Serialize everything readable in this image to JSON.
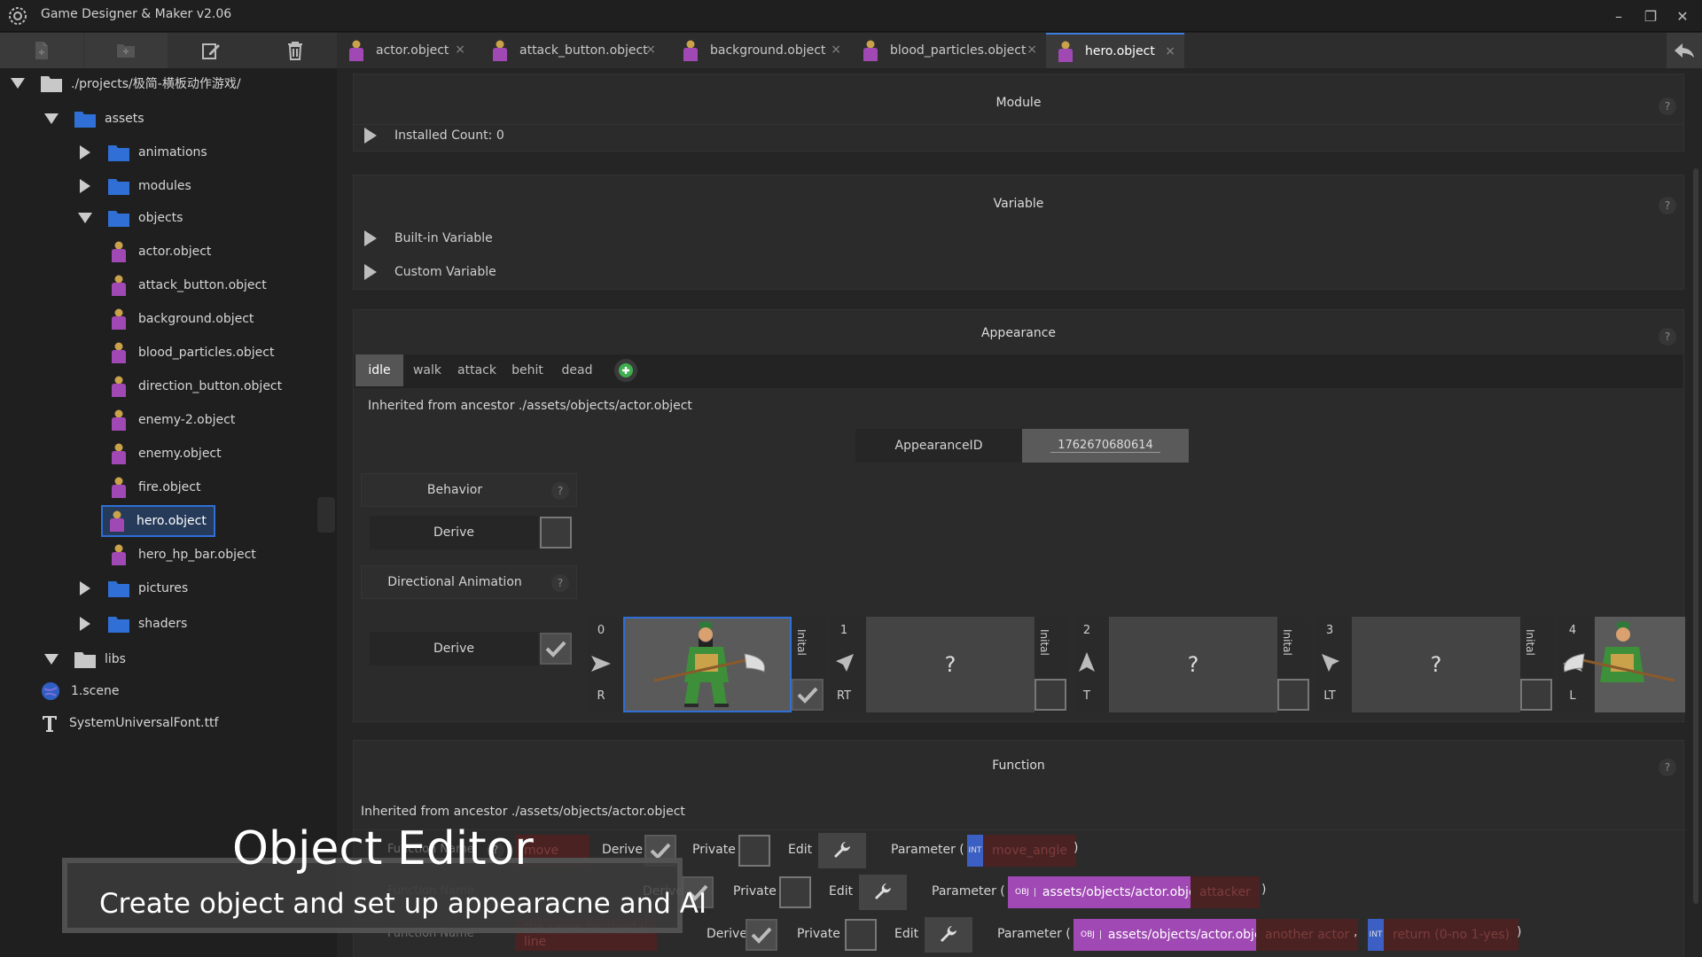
{
  "app": {
    "title": "Game Designer & Maker v2.06",
    "window_buttons": [
      "–",
      "❐",
      "✕"
    ]
  },
  "sidebar": {
    "toolbar": [
      "new-file-icon",
      "new-folder-icon",
      "edit-icon",
      "delete-icon"
    ],
    "root": "./projects/极简-横板动作游戏/",
    "tree": {
      "assets": "assets",
      "animations": "animations",
      "modules": "modules",
      "objects": "objects",
      "object_files": [
        "actor.object",
        "attack_button.object",
        "background.object",
        "blood_particles.object",
        "direction_button.object",
        "enemy-2.object",
        "enemy.object",
        "fire.object",
        "hero.object",
        "hero_hp_bar.object"
      ],
      "pictures": "pictures",
      "shaders": "shaders",
      "libs": "libs",
      "scene": "1.scene",
      "font": "SystemUniversalFont.ttf"
    }
  },
  "tabs": [
    {
      "label": "actor.object",
      "active": false
    },
    {
      "label": "attack_button.object",
      "active": false
    },
    {
      "label": "background.object",
      "active": false
    },
    {
      "label": "blood_particles.object",
      "active": false
    },
    {
      "label": "hero.object",
      "active": true
    }
  ],
  "tab_close": "×",
  "module": {
    "title": "Module",
    "installed": "Installed Count: 0"
  },
  "variable": {
    "title": "Variable",
    "builtin": "Built-in Variable",
    "custom": "Custom Variable"
  },
  "appearance": {
    "title": "Appearance",
    "states": [
      "idle",
      "walk",
      "attack",
      "behit",
      "dead"
    ],
    "active_state": "idle",
    "inherited": "Inherited from ancestor ./assets/objects/actor.object",
    "id_label": "AppearanceID",
    "id_value": "1762670680614",
    "behavior_label": "Behavior",
    "derive": "Derive",
    "behavior_derive_checked": false,
    "dir_anim_label": "Directional Animation",
    "dir_derive_checked": true,
    "directions": [
      {
        "num": "0",
        "label": "R",
        "img": "hero",
        "initial": true
      },
      {
        "num": "1",
        "label": "RT",
        "img": "?",
        "initial": false
      },
      {
        "num": "2",
        "label": "T",
        "img": "?",
        "initial": false
      },
      {
        "num": "3",
        "label": "LT",
        "img": "?",
        "initial": false
      },
      {
        "num": "4",
        "label": "L",
        "img": "hero-flipped",
        "initial": false
      }
    ],
    "initial_label": "Inital"
  },
  "function": {
    "title": "Function",
    "inherited": "Inherited from ancestor ./assets/objects/actor.object",
    "row_labels": {
      "function_name": "Function Name",
      "derive": "Derive",
      "private": "Private",
      "edit": "Edit",
      "parameter": "Parameter ("
    },
    "rows": [
      {
        "name": "move",
        "params": [
          {
            "type": "INT",
            "name": "move_angle"
          }
        ]
      },
      {
        "name": "",
        "params": [
          {
            "type": "OBJ",
            "value": "assets/objects/actor.object",
            "name": "attacker"
          }
        ]
      },
      {
        "name": "the same horizontal line",
        "params": [
          {
            "type": "OBJ",
            "value": "assets/objects/actor.object",
            "name": "another actor"
          },
          {
            "type": "INT",
            "name": "return (0-no 1-yes)"
          }
        ]
      }
    ]
  },
  "caption": {
    "title": "Object Editor",
    "subtitle": "Create object and set up appearacne and AI"
  },
  "colors": {
    "accent": "#3b7ddd",
    "purple_param": "#a049b4",
    "int_tag": "#3c5fc4",
    "folder": "#2f6fd6"
  }
}
